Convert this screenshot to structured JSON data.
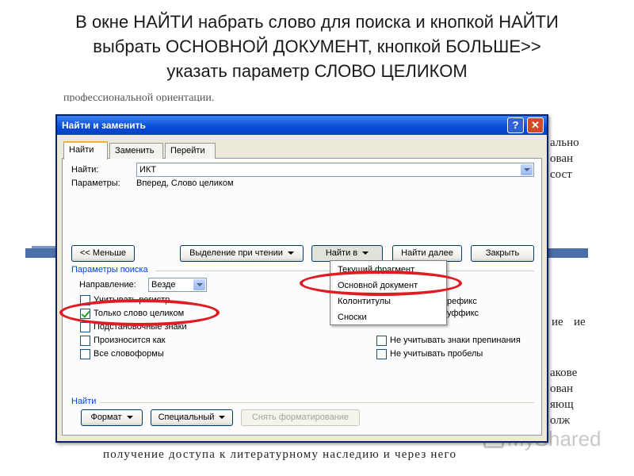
{
  "slide": {
    "title_lines": [
      "В окне НАЙТИ набрать слово для поиска и кнопкой НАЙТИ",
      "выбрать ОСНОВНОЙ ДОКУМЕНТ, кнопкой  БОЛЬШЕ>>",
      "указать параметр СЛОВО ЦЕЛИКОМ"
    ]
  },
  "background_doc": {
    "top_line": "профессиональной ориентации.",
    "bottom_line": "получение  доступа  к  литературному  наследию  и  через  него",
    "right_fragments": [
      "ально",
      "ован",
      "сост",
      "ие",
      "акове",
      "ован",
      "яющ",
      "олж",
      "ие"
    ],
    "watermark": "MyShared"
  },
  "dialog": {
    "title": "Найти и заменить",
    "help_button": "?",
    "close_button": "✕",
    "tabs": [
      "Найти",
      "Заменить",
      "Перейти"
    ],
    "find_label": "Найти:",
    "find_value": "ИКТ",
    "params_label": "Параметры:",
    "params_value": "Вперед, Слово целиком",
    "buttons": {
      "less": "<< Меньше",
      "reading_highlight": "Выделение при чтении",
      "find_in": "Найти в",
      "find_next": "Найти далее",
      "close": "Закрыть"
    },
    "search_params_header": "Параметры поиска",
    "direction_label": "Направление:",
    "direction_value": "Везде",
    "checkboxes": [
      {
        "label": "Учитывать регистр",
        "checked": false
      },
      {
        "label": "Только слово целиком",
        "checked": true
      },
      {
        "label": "Подстановочные знаки",
        "checked": false
      },
      {
        "label": "Произносится как",
        "checked": false
      },
      {
        "label": "Все словоформы",
        "checked": false
      }
    ],
    "right_partials": [
      "рефикс",
      "уффикс"
    ],
    "right_checkboxes": [
      {
        "label": "Не учитывать знаки препинания",
        "checked": false
      },
      {
        "label": "Не учитывать пробелы",
        "checked": false
      }
    ],
    "find_section_header": "Найти",
    "bottom_buttons": {
      "format": "Формат",
      "special": "Специальный",
      "clear_format": "Снять форматирование"
    },
    "find_in_menu": [
      "Текущий фрагмент",
      "Основной документ",
      "Колонтитулы",
      "Сноски"
    ]
  },
  "annotation_color": "#e11b22"
}
